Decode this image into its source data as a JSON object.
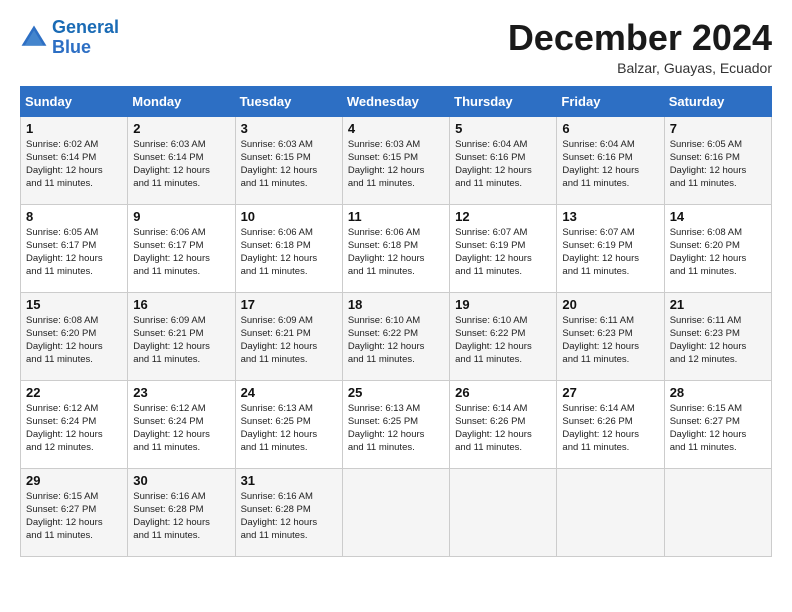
{
  "logo": {
    "line1": "General",
    "line2": "Blue"
  },
  "title": "December 2024",
  "subtitle": "Balzar, Guayas, Ecuador",
  "days_header": [
    "Sunday",
    "Monday",
    "Tuesday",
    "Wednesday",
    "Thursday",
    "Friday",
    "Saturday"
  ],
  "weeks": [
    [
      {
        "day": "1",
        "info": "Sunrise: 6:02 AM\nSunset: 6:14 PM\nDaylight: 12 hours\nand 11 minutes."
      },
      {
        "day": "2",
        "info": "Sunrise: 6:03 AM\nSunset: 6:14 PM\nDaylight: 12 hours\nand 11 minutes."
      },
      {
        "day": "3",
        "info": "Sunrise: 6:03 AM\nSunset: 6:15 PM\nDaylight: 12 hours\nand 11 minutes."
      },
      {
        "day": "4",
        "info": "Sunrise: 6:03 AM\nSunset: 6:15 PM\nDaylight: 12 hours\nand 11 minutes."
      },
      {
        "day": "5",
        "info": "Sunrise: 6:04 AM\nSunset: 6:16 PM\nDaylight: 12 hours\nand 11 minutes."
      },
      {
        "day": "6",
        "info": "Sunrise: 6:04 AM\nSunset: 6:16 PM\nDaylight: 12 hours\nand 11 minutes."
      },
      {
        "day": "7",
        "info": "Sunrise: 6:05 AM\nSunset: 6:16 PM\nDaylight: 12 hours\nand 11 minutes."
      }
    ],
    [
      {
        "day": "8",
        "info": "Sunrise: 6:05 AM\nSunset: 6:17 PM\nDaylight: 12 hours\nand 11 minutes."
      },
      {
        "day": "9",
        "info": "Sunrise: 6:06 AM\nSunset: 6:17 PM\nDaylight: 12 hours\nand 11 minutes."
      },
      {
        "day": "10",
        "info": "Sunrise: 6:06 AM\nSunset: 6:18 PM\nDaylight: 12 hours\nand 11 minutes."
      },
      {
        "day": "11",
        "info": "Sunrise: 6:06 AM\nSunset: 6:18 PM\nDaylight: 12 hours\nand 11 minutes."
      },
      {
        "day": "12",
        "info": "Sunrise: 6:07 AM\nSunset: 6:19 PM\nDaylight: 12 hours\nand 11 minutes."
      },
      {
        "day": "13",
        "info": "Sunrise: 6:07 AM\nSunset: 6:19 PM\nDaylight: 12 hours\nand 11 minutes."
      },
      {
        "day": "14",
        "info": "Sunrise: 6:08 AM\nSunset: 6:20 PM\nDaylight: 12 hours\nand 11 minutes."
      }
    ],
    [
      {
        "day": "15",
        "info": "Sunrise: 6:08 AM\nSunset: 6:20 PM\nDaylight: 12 hours\nand 11 minutes."
      },
      {
        "day": "16",
        "info": "Sunrise: 6:09 AM\nSunset: 6:21 PM\nDaylight: 12 hours\nand 11 minutes."
      },
      {
        "day": "17",
        "info": "Sunrise: 6:09 AM\nSunset: 6:21 PM\nDaylight: 12 hours\nand 11 minutes."
      },
      {
        "day": "18",
        "info": "Sunrise: 6:10 AM\nSunset: 6:22 PM\nDaylight: 12 hours\nand 11 minutes."
      },
      {
        "day": "19",
        "info": "Sunrise: 6:10 AM\nSunset: 6:22 PM\nDaylight: 12 hours\nand 11 minutes."
      },
      {
        "day": "20",
        "info": "Sunrise: 6:11 AM\nSunset: 6:23 PM\nDaylight: 12 hours\nand 11 minutes."
      },
      {
        "day": "21",
        "info": "Sunrise: 6:11 AM\nSunset: 6:23 PM\nDaylight: 12 hours\nand 12 minutes."
      }
    ],
    [
      {
        "day": "22",
        "info": "Sunrise: 6:12 AM\nSunset: 6:24 PM\nDaylight: 12 hours\nand 12 minutes."
      },
      {
        "day": "23",
        "info": "Sunrise: 6:12 AM\nSunset: 6:24 PM\nDaylight: 12 hours\nand 11 minutes."
      },
      {
        "day": "24",
        "info": "Sunrise: 6:13 AM\nSunset: 6:25 PM\nDaylight: 12 hours\nand 11 minutes."
      },
      {
        "day": "25",
        "info": "Sunrise: 6:13 AM\nSunset: 6:25 PM\nDaylight: 12 hours\nand 11 minutes."
      },
      {
        "day": "26",
        "info": "Sunrise: 6:14 AM\nSunset: 6:26 PM\nDaylight: 12 hours\nand 11 minutes."
      },
      {
        "day": "27",
        "info": "Sunrise: 6:14 AM\nSunset: 6:26 PM\nDaylight: 12 hours\nand 11 minutes."
      },
      {
        "day": "28",
        "info": "Sunrise: 6:15 AM\nSunset: 6:27 PM\nDaylight: 12 hours\nand 11 minutes."
      }
    ],
    [
      {
        "day": "29",
        "info": "Sunrise: 6:15 AM\nSunset: 6:27 PM\nDaylight: 12 hours\nand 11 minutes."
      },
      {
        "day": "30",
        "info": "Sunrise: 6:16 AM\nSunset: 6:28 PM\nDaylight: 12 hours\nand 11 minutes."
      },
      {
        "day": "31",
        "info": "Sunrise: 6:16 AM\nSunset: 6:28 PM\nDaylight: 12 hours\nand 11 minutes."
      },
      null,
      null,
      null,
      null
    ]
  ]
}
